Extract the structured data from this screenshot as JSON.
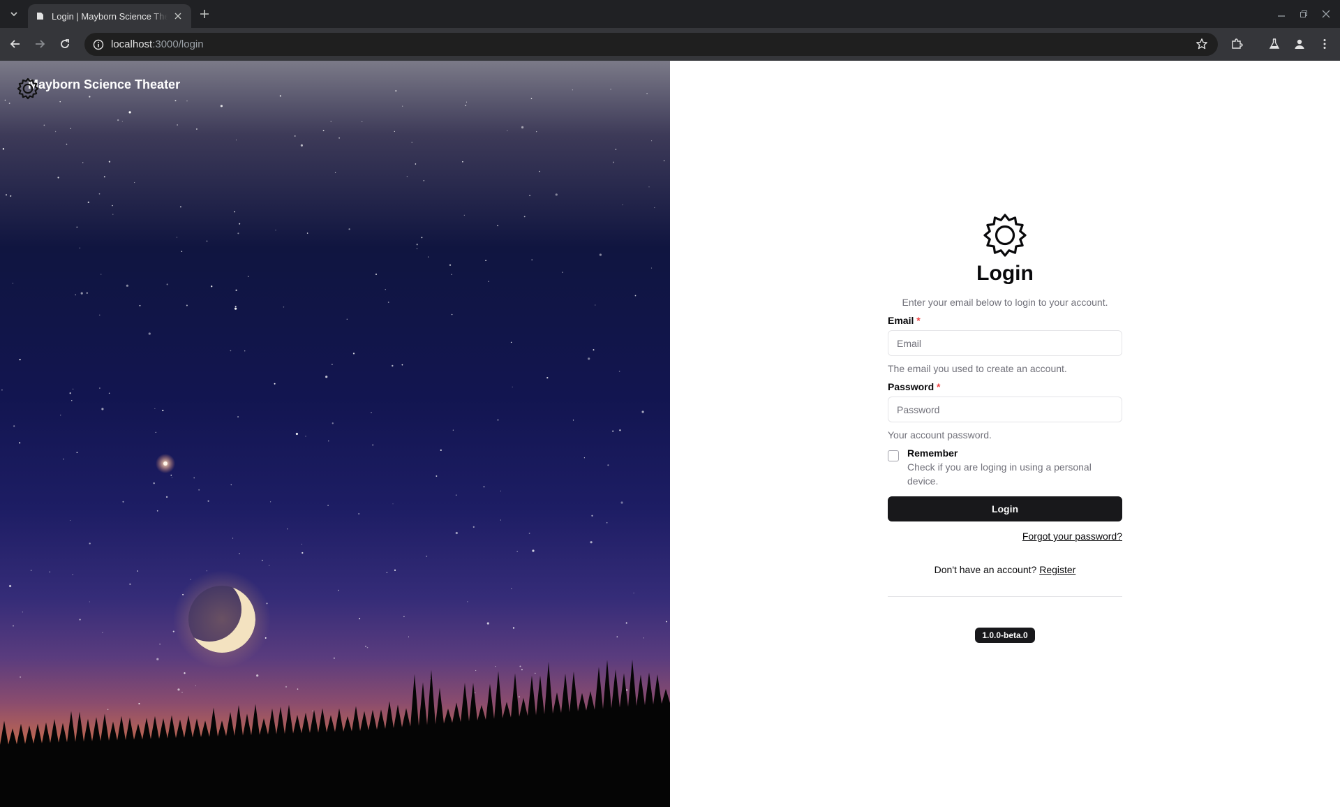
{
  "browser": {
    "tab_title": "Login | Mayborn Science Theater",
    "url_host": "localhost",
    "url_rest": ":3000/login"
  },
  "brand": {
    "name": "Mayborn Science Theater"
  },
  "login": {
    "title": "Login",
    "subtitle": "Enter your email below to login to your account.",
    "email_label": "Email",
    "email_placeholder": "Email",
    "email_hint": "The email you used to create an account.",
    "password_label": "Password",
    "password_placeholder": "Password",
    "password_hint": "Your account password.",
    "remember_label": "Remember",
    "remember_desc": "Check if you are loging in using a personal device.",
    "submit_label": "Login",
    "forgot_label": "Forgot your password?",
    "register_prompt": "Don't have an account?",
    "register_label": "Register",
    "required_mark": "*",
    "version": "1.0.0-beta.0"
  },
  "colors": {
    "primary": "#18181b",
    "required": "#ef4444",
    "muted": "#71717a"
  }
}
